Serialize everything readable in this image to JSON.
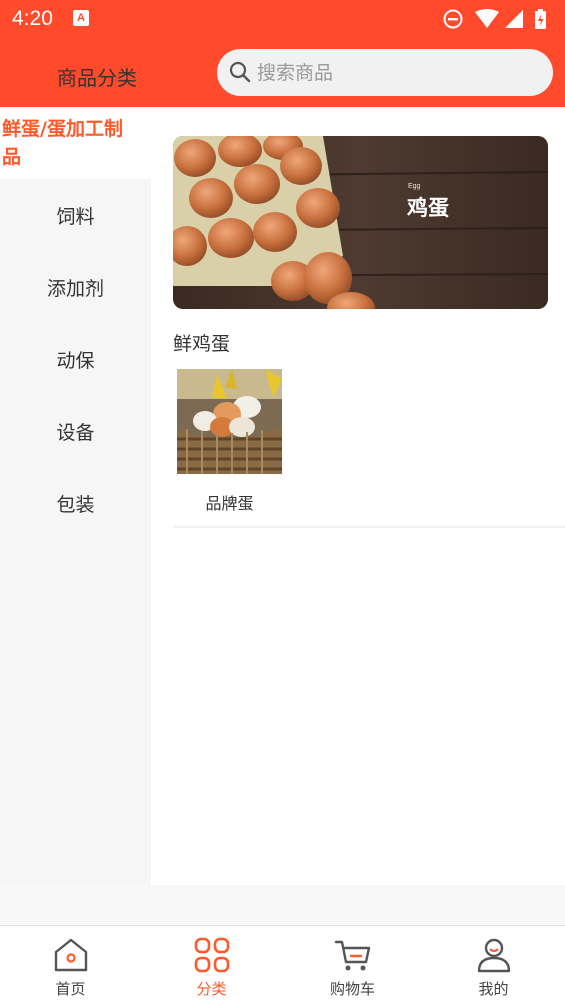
{
  "status_bar": {
    "time": "4:20",
    "notification_letter": "A"
  },
  "header": {
    "title": "商品分类",
    "search_placeholder": "搜索商品"
  },
  "sidebar": {
    "active_line1": "鲜蛋/蛋加工制",
    "active_line2": "品",
    "items": [
      {
        "label": "饲料"
      },
      {
        "label": "添加剂"
      },
      {
        "label": "动保"
      },
      {
        "label": "设备"
      },
      {
        "label": "包装"
      }
    ]
  },
  "content": {
    "banner": {
      "small_text": "Egg",
      "big_text": "鸡蛋"
    },
    "section_title": "鲜鸡蛋",
    "products": [
      {
        "label": "品牌蛋"
      }
    ]
  },
  "tabbar": {
    "items": [
      {
        "label": "首页",
        "icon": "home-icon"
      },
      {
        "label": "分类",
        "icon": "category-icon"
      },
      {
        "label": "购物车",
        "icon": "cart-icon"
      },
      {
        "label": "我的",
        "icon": "user-icon"
      }
    ]
  },
  "colors": {
    "accent": "#ff4b2b",
    "active_text": "#ff5a2c"
  }
}
